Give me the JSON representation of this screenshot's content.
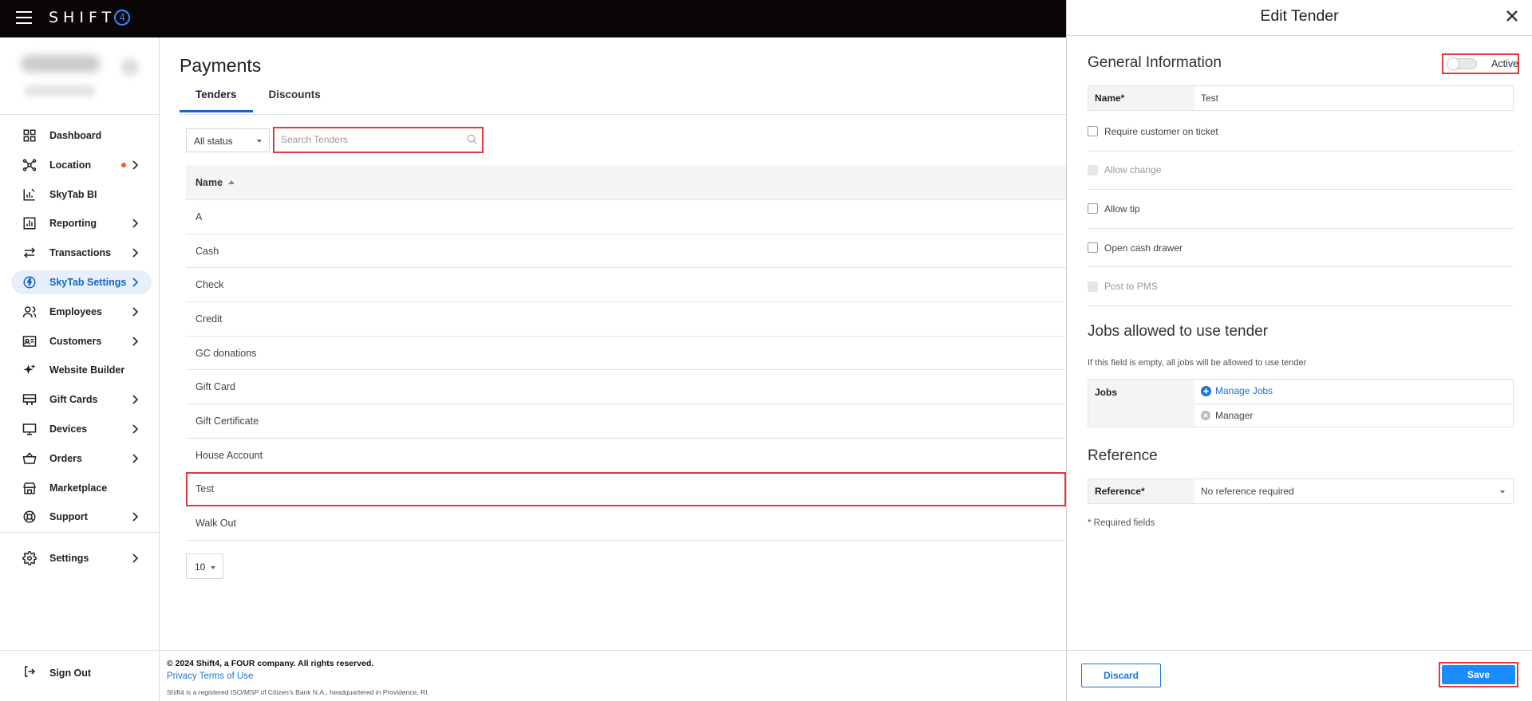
{
  "app": {
    "logo_text": "SHIFT",
    "logo_digit": "4"
  },
  "sidebar": {
    "items": [
      {
        "label": "Dashboard",
        "icon": "dashboard-icon",
        "chevron": false,
        "dot": false,
        "active": false
      },
      {
        "label": "Location",
        "icon": "location-network-icon",
        "chevron": true,
        "dot": true,
        "active": false
      },
      {
        "label": "SkyTab BI",
        "icon": "bi-chart-icon",
        "chevron": false,
        "dot": false,
        "active": false
      },
      {
        "label": "Reporting",
        "icon": "reporting-icon",
        "chevron": true,
        "dot": false,
        "active": false
      },
      {
        "label": "Transactions",
        "icon": "transactions-icon",
        "chevron": true,
        "dot": false,
        "active": false
      },
      {
        "label": "SkyTab Settings",
        "icon": "skytab-settings-icon",
        "chevron": true,
        "dot": false,
        "active": true
      },
      {
        "label": "Employees",
        "icon": "employees-icon",
        "chevron": true,
        "dot": false,
        "active": false
      },
      {
        "label": "Customers",
        "icon": "customers-icon",
        "chevron": true,
        "dot": false,
        "active": false
      },
      {
        "label": "Website Builder",
        "icon": "sparkle-icon",
        "chevron": false,
        "dot": false,
        "active": false
      },
      {
        "label": "Gift Cards",
        "icon": "gift-card-icon",
        "chevron": true,
        "dot": false,
        "active": false
      },
      {
        "label": "Devices",
        "icon": "devices-icon",
        "chevron": true,
        "dot": false,
        "active": false
      },
      {
        "label": "Orders",
        "icon": "basket-icon",
        "chevron": true,
        "dot": false,
        "active": false
      },
      {
        "label": "Marketplace",
        "icon": "store-icon",
        "chevron": false,
        "dot": false,
        "active": false
      },
      {
        "label": "Support",
        "icon": "lifebuoy-icon",
        "chevron": true,
        "dot": false,
        "active": false
      }
    ],
    "settings_label": "Settings",
    "signout_label": "Sign Out"
  },
  "main": {
    "title": "Payments",
    "tabs": [
      {
        "label": "Tenders",
        "active": true
      },
      {
        "label": "Discounts",
        "active": false
      }
    ],
    "status_filter": "All status",
    "search_placeholder": "Search Tenders",
    "table": {
      "header": "Name",
      "rows": [
        "A",
        "Cash",
        "Check",
        "Credit",
        "GC donations",
        "Gift Card",
        "Gift Certificate",
        "House Account",
        "Test",
        "Walk Out"
      ],
      "highlighted_row": "Test"
    },
    "page_size": "10"
  },
  "footer": {
    "copyright": "© 2024 Shift4, a FOUR company. All rights reserved.",
    "privacy_label": "Privacy",
    "terms_label": "Terms of Use",
    "fineprint": "Shift4 is a registered ISO/MSP of Citizen's Bank N.A., headquartered in Providence, RI."
  },
  "panel": {
    "title": "Edit Tender",
    "general_title": "General Information",
    "active_label": "Active",
    "active_on": false,
    "name_label": "Name*",
    "name_value": "Test",
    "checkboxes": [
      {
        "label": "Require customer on ticket",
        "disabled": false,
        "checked": false
      },
      {
        "label": "Allow change",
        "disabled": true,
        "checked": false
      },
      {
        "label": "Allow tip",
        "disabled": false,
        "checked": false
      },
      {
        "label": "Open cash drawer",
        "disabled": false,
        "checked": false
      },
      {
        "label": "Post to PMS",
        "disabled": true,
        "checked": false
      }
    ],
    "jobs_title": "Jobs allowed to use tender",
    "jobs_note": "If this field is empty, all jobs will be allowed to use tender",
    "jobs_label": "Jobs",
    "manage_jobs_label": "Manage Jobs",
    "job_tag": "Manager",
    "reference_title": "Reference",
    "reference_label": "Reference*",
    "reference_value": "No reference required",
    "required_note": "* Required fields",
    "discard_label": "Discard",
    "save_label": "Save",
    "colors": {
      "accent": "#1a73d9",
      "save": "#1a8cff",
      "highlight": "#e0393e"
    }
  }
}
